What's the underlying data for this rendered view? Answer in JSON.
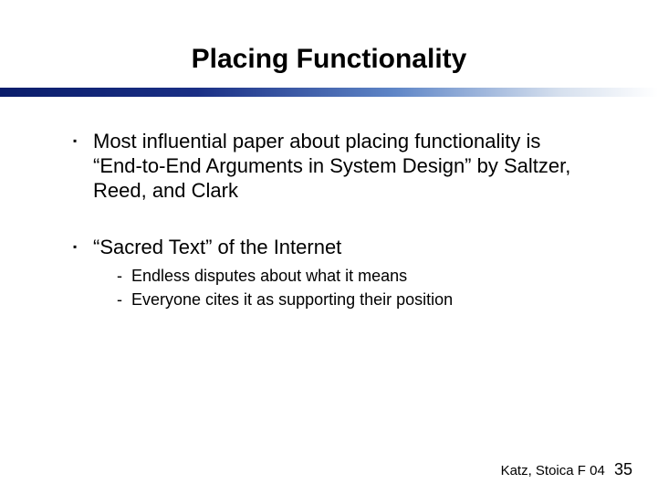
{
  "title": "Placing Functionality",
  "bullets": [
    {
      "text": "Most influential paper about placing functionality is “End-to-End Arguments in System Design” by Saltzer, Reed, and Clark",
      "sub": []
    },
    {
      "text": "“Sacred Text” of the Internet",
      "sub": [
        "Endless disputes about what it means",
        "Everyone cites it as supporting their position"
      ]
    }
  ],
  "footer": {
    "credit": "Katz, Stoica F 04",
    "page": "35"
  }
}
